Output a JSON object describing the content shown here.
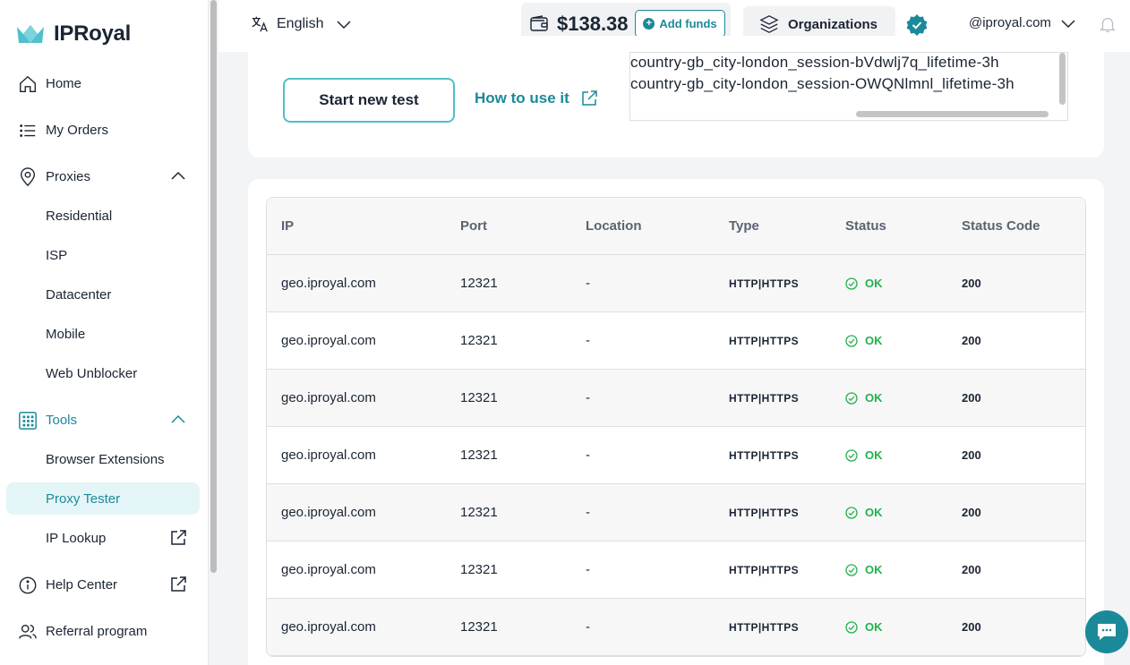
{
  "brand": {
    "name": "IPRoyal",
    "accent": "#1a8a9a"
  },
  "sidebar": {
    "home": "Home",
    "orders": "My Orders",
    "proxies": "Proxies",
    "proxy_items": [
      "Residential",
      "ISP",
      "Datacenter",
      "Mobile",
      "Web Unblocker"
    ],
    "tools": "Tools",
    "tool_items": [
      "Browser Extensions",
      "Proxy Tester",
      "IP Lookup"
    ],
    "help": "Help Center",
    "referral": "Referral program"
  },
  "topbar": {
    "language": "English",
    "balance": "$138.38",
    "add_funds": "Add funds",
    "organizations": "Organizations",
    "account": "@iproyal.com"
  },
  "tester": {
    "start_button": "Start new test",
    "how_link": "How to use it",
    "output_lines": [
      "country-gb_city-london_session-bVdwlj7q_lifetime-3h",
      "country-gb_city-london_session-OWQNlmnl_lifetime-3h"
    ]
  },
  "table": {
    "headers": [
      "IP",
      "Port",
      "Location",
      "Type",
      "Status",
      "Status Code"
    ],
    "rows": [
      [
        "geo.iproyal.com",
        "12321",
        "-",
        "HTTP|HTTPS",
        "OK",
        "200"
      ],
      [
        "geo.iproyal.com",
        "12321",
        "-",
        "HTTP|HTTPS",
        "OK",
        "200"
      ],
      [
        "geo.iproyal.com",
        "12321",
        "-",
        "HTTP|HTTPS",
        "OK",
        "200"
      ],
      [
        "geo.iproyal.com",
        "12321",
        "-",
        "HTTP|HTTPS",
        "OK",
        "200"
      ],
      [
        "geo.iproyal.com",
        "12321",
        "-",
        "HTTP|HTTPS",
        "OK",
        "200"
      ],
      [
        "geo.iproyal.com",
        "12321",
        "-",
        "HTTP|HTTPS",
        "OK",
        "200"
      ],
      [
        "geo.iproyal.com",
        "12321",
        "-",
        "HTTP|HTTPS",
        "OK",
        "200"
      ]
    ]
  }
}
